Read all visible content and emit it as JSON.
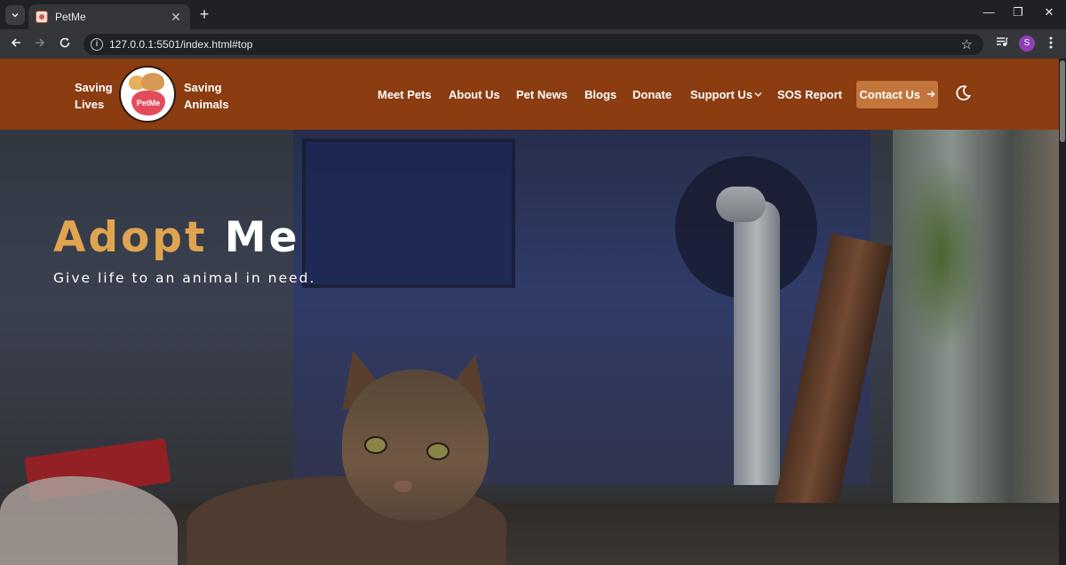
{
  "browser": {
    "tab_title": "PetMe",
    "tab_close": "✕",
    "new_tab": "+",
    "url": "127.0.0.1:5501/index.html#top",
    "profile_initial": "S",
    "minimize": "—",
    "restore": "❐",
    "close": "✕"
  },
  "site": {
    "logo_text": "PetMe",
    "slogan_left": [
      "Saving",
      "Lives"
    ],
    "slogan_right": [
      "Saving",
      "Animals"
    ],
    "nav": [
      {
        "label": "Meet Pets"
      },
      {
        "label": "About Us"
      },
      {
        "label": "Pet News"
      },
      {
        "label": "Blogs"
      },
      {
        "label": "Donate"
      },
      {
        "label": "Support Us",
        "has_dropdown": true
      },
      {
        "label": "SOS Report"
      }
    ],
    "contact_label": "Contact Us",
    "header_color": "#8b3c11",
    "accent_color": "#c2763c"
  },
  "hero": {
    "title_word1": "Adopt",
    "title_word2": "Me",
    "subtitle": "Give life to an animal in need.",
    "title_accent_color": "#e0a451"
  },
  "icons": {
    "tab_search": "chevron-down-icon",
    "back": "arrow-left-icon",
    "forward": "arrow-right-icon",
    "reload": "reload-icon",
    "site_info": "info-icon",
    "bookmark": "star-icon",
    "media": "media-controls-icon",
    "menu": "kebab-menu-icon",
    "theme": "moon-icon"
  }
}
